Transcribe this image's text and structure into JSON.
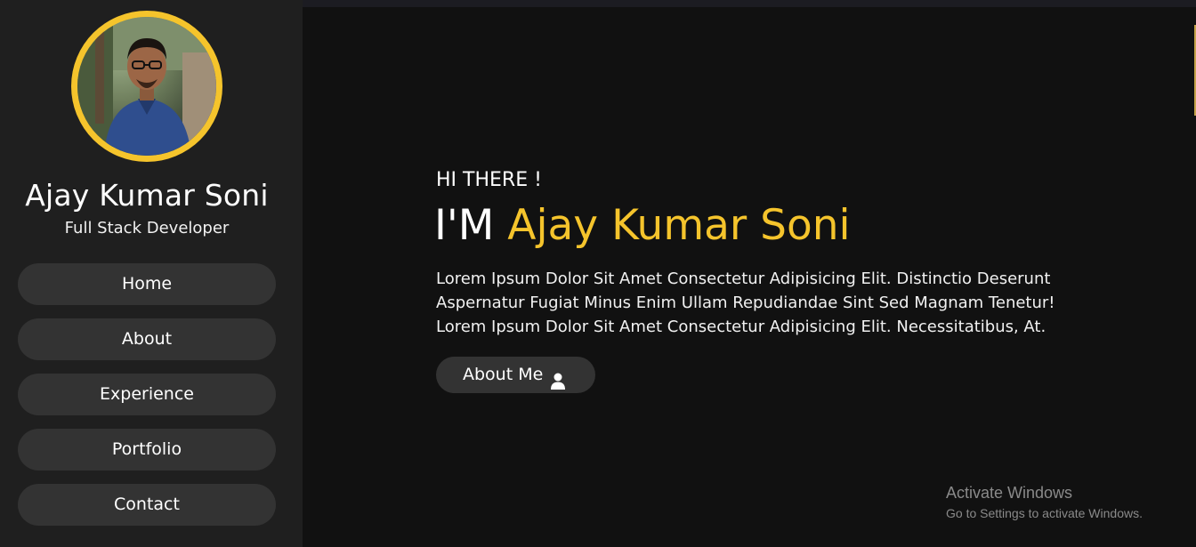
{
  "sidebar": {
    "name": "Ajay Kumar Soni",
    "role": "Full Stack Developer",
    "nav": [
      {
        "label": "Home"
      },
      {
        "label": "About"
      },
      {
        "label": "Experience"
      },
      {
        "label": "Portfolio"
      },
      {
        "label": "Contact"
      }
    ]
  },
  "hero": {
    "greeting": "HI THERE !",
    "prefix": "I'M",
    "name": "Ajay Kumar Soni",
    "description": "Lorem Ipsum Dolor Sit Amet Consectetur Adipisicing Elit. Distinctio Deserunt Aspernatur Fugiat Minus Enim Ullam Repudiandae Sint Sed Magnam Tenetur! Lorem Ipsum Dolor Sit Amet Consectetur Adipisicing Elit. Necessitatibus, At.",
    "button_label": "About Me",
    "button_icon": "user-icon"
  },
  "watermark": {
    "title": "Activate Windows",
    "subtitle": "Go to Settings to activate Windows."
  },
  "colors": {
    "accent": "#f5c42c",
    "sidebar_bg": "#1f1f1f",
    "main_bg": "#111111",
    "button_bg": "#333333"
  }
}
